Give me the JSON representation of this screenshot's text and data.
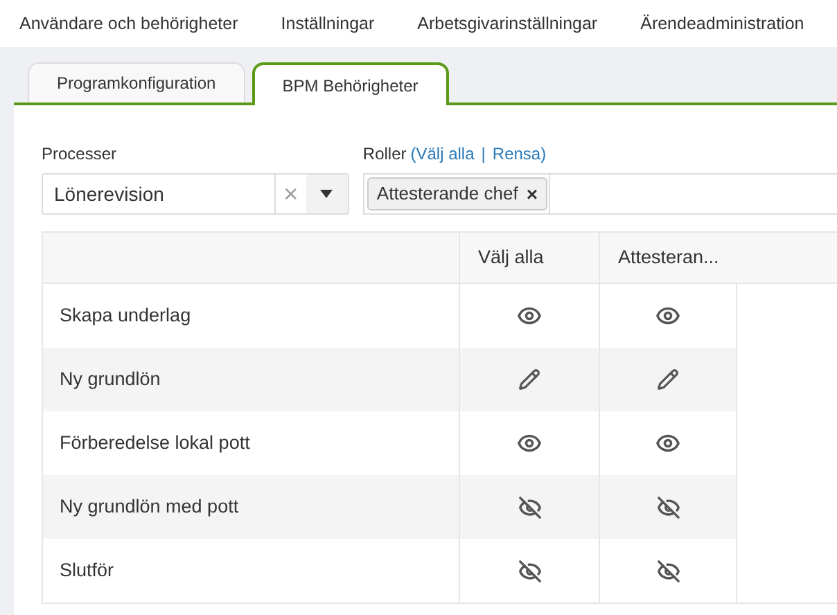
{
  "nav": [
    {
      "label": "Användare och behörigheter"
    },
    {
      "label": "Inställningar"
    },
    {
      "label": "Arbetsgivarinställningar"
    },
    {
      "label": "Ärendeadministration"
    }
  ],
  "tabs": [
    {
      "label": "Programkonfiguration",
      "selected": false
    },
    {
      "label": "BPM Behörigheter",
      "selected": true
    }
  ],
  "processes": {
    "label": "Processer",
    "value": "Lönerevision",
    "clear": "×"
  },
  "roles": {
    "label": "Roller",
    "open": "(",
    "select_all": "Välj alla",
    "separator": "|",
    "clear": "Rensa",
    "close": ")",
    "tags": [
      {
        "label": "Attesterande chef",
        "remove": "×"
      }
    ]
  },
  "table": {
    "columns": [
      "Välj alla",
      "Attesteran..."
    ],
    "rows": [
      {
        "name": "Skapa underlag",
        "cells": [
          {
            "kind": "view"
          },
          {
            "kind": "view"
          }
        ]
      },
      {
        "name": "Ny grundlön",
        "cells": [
          {
            "kind": "edit"
          },
          {
            "kind": "edit"
          }
        ]
      },
      {
        "name": "Förberedelse lokal pott",
        "cells": [
          {
            "kind": "view"
          },
          {
            "kind": "view"
          }
        ]
      },
      {
        "name": "Ny grundlön med pott",
        "cells": [
          {
            "kind": "hidden"
          },
          {
            "kind": "hidden"
          }
        ]
      },
      {
        "name": "Slutför",
        "cells": [
          {
            "kind": "hidden"
          },
          {
            "kind": "hidden"
          }
        ]
      }
    ]
  }
}
